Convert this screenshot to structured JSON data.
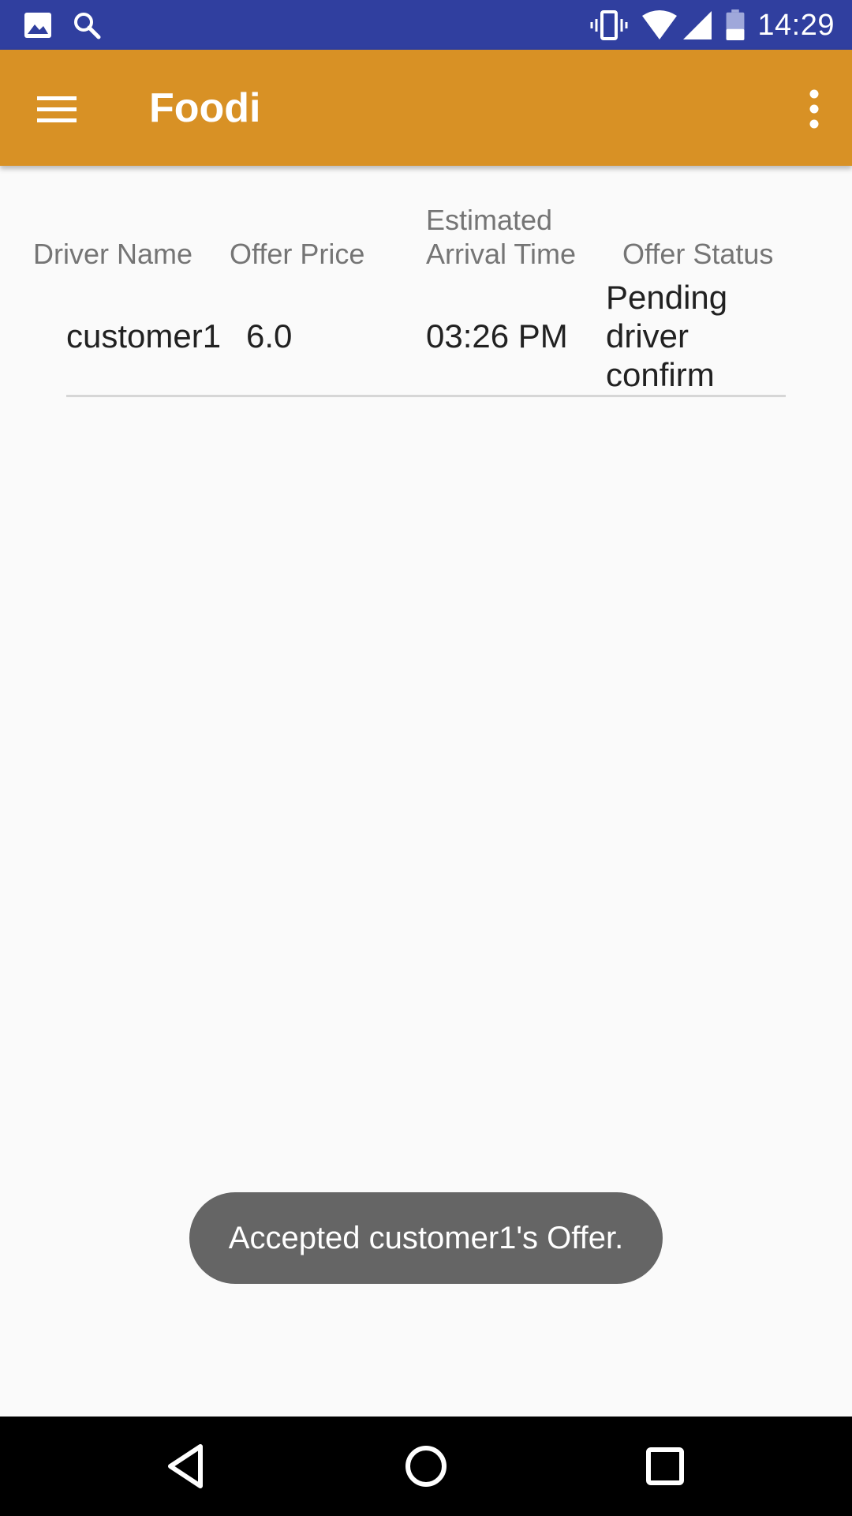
{
  "status_bar": {
    "time": "14:29",
    "left_icons": [
      "image-notification-icon",
      "search-notification-icon"
    ],
    "right_icons": [
      "vibrate-icon",
      "wifi-icon",
      "cell-signal-icon",
      "battery-icon"
    ],
    "background": "#303F9F"
  },
  "toolbar": {
    "title": "Foodi",
    "menu_icon": "hamburger-menu-icon",
    "overflow_icon": "more-vert-icon",
    "background": "#D89125"
  },
  "table": {
    "headers": {
      "driver_name": "Driver Name",
      "offer_price": "Offer Price",
      "eta_line1": "Estimated",
      "eta_line2": "Arrival Time",
      "offer_status": "Offer Status"
    },
    "rows": [
      {
        "driver_name": "customer1",
        "offer_price": "6.0",
        "eta": "03:26 PM",
        "status_line1": "Pending",
        "status_line2": "driver",
        "status_line3": "confirm"
      }
    ]
  },
  "toast": {
    "message": "Accepted customer1's Offer."
  },
  "nav_bar": {
    "icons": [
      "back-icon",
      "home-icon",
      "recents-icon"
    ]
  }
}
